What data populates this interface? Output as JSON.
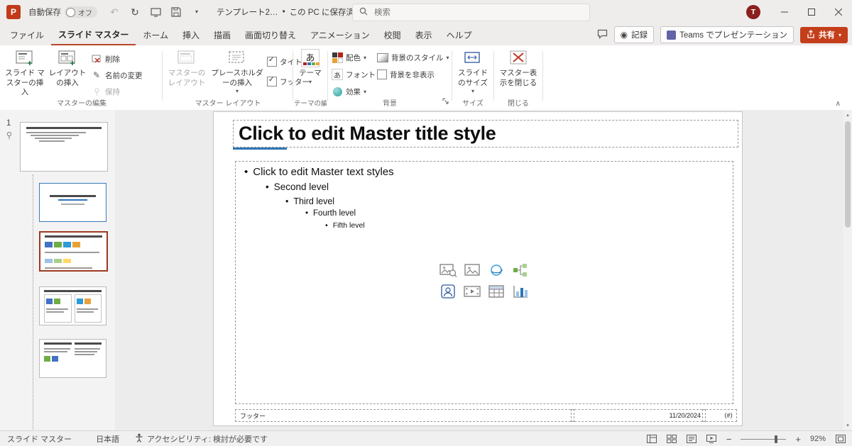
{
  "titlebar": {
    "app_initial": "P",
    "autosave_label": "自動保存",
    "autosave_state": "オフ",
    "doc_title": "テンプレート2…",
    "separator": "•",
    "doc_status": "この PC に保存済み",
    "search_placeholder": "検索",
    "avatar_initial": "T"
  },
  "tabs": {
    "items": [
      "ファイル",
      "スライド マスター",
      "ホーム",
      "挿入",
      "描画",
      "画面切り替え",
      "アニメーション",
      "校閲",
      "表示",
      "ヘルプ"
    ],
    "record_label": "記録",
    "teams_label": "Teams でプレゼンテーション",
    "share_label": "共有"
  },
  "ribbon": {
    "groups": {
      "edit_master": {
        "label": "マスターの編集",
        "insert_slide_master": "スライド マスターの挿入",
        "insert_layout": "レイアウトの挿入",
        "delete": "削除",
        "rename": "名前の変更",
        "preserve": "保持"
      },
      "master_layout": {
        "label": "マスター レイアウト",
        "master_layout_btn": "マスターのレイアウト",
        "insert_placeholder": "プレースホルダーの挿入",
        "title_checkbox": "タイトル",
        "footer_checkbox": "フッター"
      },
      "edit_theme": {
        "label": "テーマの編集",
        "themes": "テーマ"
      },
      "background": {
        "label": "背景",
        "colors": "配色",
        "fonts": "フォント",
        "effects": "効果",
        "bg_styles": "背景のスタイル",
        "hide_bg": "背景を非表示"
      },
      "size": {
        "label": "サイズ",
        "slide_size": "スライドのサイズ"
      },
      "close": {
        "label": "閉じる",
        "close_master": "マスター表示を閉じる"
      }
    }
  },
  "thumbnails": {
    "slide_number": "1"
  },
  "slide": {
    "title": "Click to edit Master title style",
    "bullet_char": "•",
    "bullets": [
      "Click to edit Master text styles",
      "Second level",
      "Third level",
      "Fourth level",
      "Fifth level"
    ],
    "footer_text": "フッター",
    "date_text": "11/20/2024",
    "slide_number_placeholder": "⟨#⟩"
  },
  "statusbar": {
    "view_label": "スライド マスター",
    "language": "日本語",
    "accessibility": "アクセシビリティ: 検討が必要です",
    "zoom": "92%"
  },
  "icons": {
    "chevron_down": "▾",
    "chevron_up": "∧",
    "undo": "↶",
    "redo": "↻",
    "record": "◉",
    "pencil": "✎",
    "theme_glyph": "あ",
    "fonts_glyph": "あ",
    "arrow_up_small": "▴",
    "arrow_down_small": "▾"
  }
}
